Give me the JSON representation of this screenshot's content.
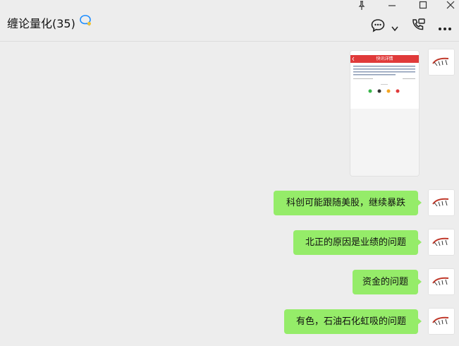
{
  "header": {
    "title": "缠论量化(35)",
    "accent": "#1aad19"
  },
  "window_controls": {
    "pin": "pin-icon",
    "minimize": "minimize-icon",
    "maximize": "maximize-icon",
    "close": "close-icon"
  },
  "toolbar": {
    "chat": "chat-bubble-icon",
    "dropdown": "chevron-down-icon",
    "call": "phone-screen-icon",
    "more": "more-icon"
  },
  "screenshot_card": {
    "header_title": "快讯详情",
    "header_color": "#e03a3a"
  },
  "messages": [
    {
      "text": "科创可能跟随美股，继续暴跌"
    },
    {
      "text": "北正的原因是业绩的问题"
    },
    {
      "text": "资金的问题"
    },
    {
      "text": "有色，石油石化虹吸的问题"
    }
  ],
  "colors": {
    "bubble": "#95ec69",
    "background": "#ededed"
  }
}
